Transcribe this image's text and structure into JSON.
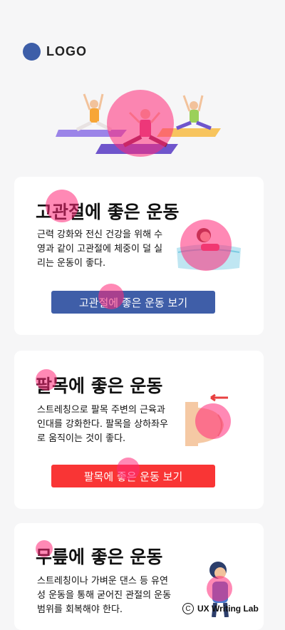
{
  "logo": {
    "text": "LOGO"
  },
  "cards": [
    {
      "title": "고관절에 좋은 운동",
      "description": "근력 강화와 전신 건강을 위해 수영과 같이 고관절에 체중이 덜 실리는 운동이 좋다.",
      "button_label": "고관절에 좋은 운동 보기",
      "button_color": "#3f5ea8"
    },
    {
      "title": "팔목에 좋은 운동",
      "description": "스트레칭으로 팔목 주변의 근육과 인대를 강화한다. 팔목을 상하좌우로 움직이는 것이 좋다.",
      "button_label": "팔목에 좋은 운동 보기",
      "button_color": "#f93535"
    },
    {
      "title": "무릎에 좋은 운동",
      "description": "스트레칭이나 가벼운 댄스 등 유연성 운동을 통해 굳어진 관절의 운동 범위를 회복해야 한다."
    }
  ],
  "credit": {
    "symbol": "C",
    "text": "UX Writing Lab"
  }
}
